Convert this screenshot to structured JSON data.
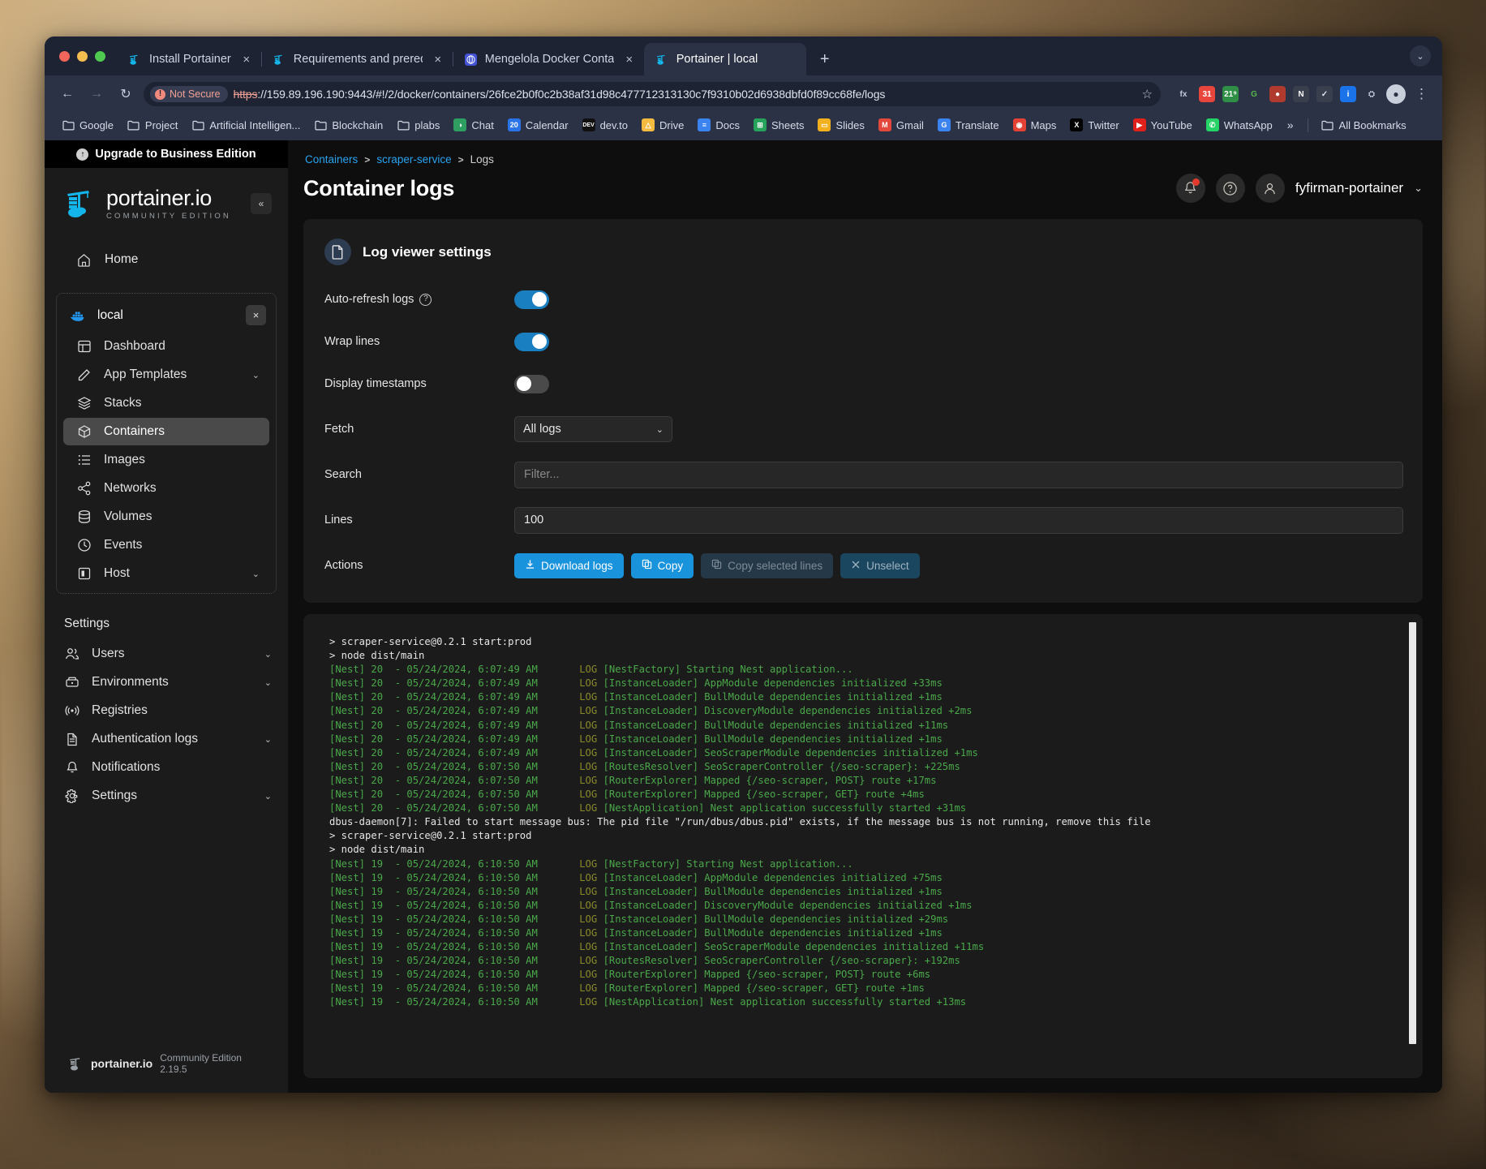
{
  "browser": {
    "tabs": [
      {
        "title": "Install Portainer",
        "favicon": "portainer-icon",
        "active": false
      },
      {
        "title": "Requirements and prerequisit",
        "favicon": "portainer-icon",
        "active": false
      },
      {
        "title": "Mengelola Docker Container c",
        "favicon": "medium-icon",
        "active": false
      },
      {
        "title": "Portainer | local",
        "favicon": "portainer-icon",
        "active": true
      }
    ],
    "new_tab_label": "+",
    "tab_close_label": "×",
    "tablist_chevron": "⌄",
    "nav": {
      "back": "←",
      "forward": "→",
      "reload": "↻"
    },
    "omnibox": {
      "security_label": "Not Secure",
      "security_icon": "not-secure-icon",
      "scheme": "https",
      "url_rest": "://159.89.196.190:9443/#!/2/docker/containers/26fce2b0f0c2b38af31d98c477712313130c7f9310b02d6938dbfd0f89cc68fe/logs",
      "bookmark_star": "☆"
    },
    "extensions": [
      {
        "name": "fx-extension-icon",
        "glyph": "fx",
        "bg": "transparent",
        "fg": "#c3cadb"
      },
      {
        "name": "calendar-31-extension-icon",
        "glyph": "31",
        "bg": "#e8453c",
        "fg": "#ffffff"
      },
      {
        "name": "calendar-219-extension-icon",
        "glyph": "21⁹",
        "bg": "#2f8f46",
        "fg": "#ffffff"
      },
      {
        "name": "grammarly-extension-icon",
        "glyph": "G",
        "bg": "transparent",
        "fg": "#57b64b"
      },
      {
        "name": "ublock-extension-icon",
        "glyph": "●",
        "bg": "#b03a2e",
        "fg": "#ffffff"
      },
      {
        "name": "notion-extension-icon",
        "glyph": "N",
        "bg": "#3a3f4d",
        "fg": "#ffffff"
      },
      {
        "name": "checkbox-extension-icon",
        "glyph": "✓",
        "bg": "#3a3f4d",
        "fg": "#dce3f0"
      },
      {
        "name": "info-extension-icon",
        "glyph": "i",
        "bg": "#1a73e8",
        "fg": "#ffffff"
      },
      {
        "name": "puzzle-extension-icon",
        "glyph": "⛭",
        "bg": "transparent",
        "fg": "#c3cadb"
      }
    ],
    "profile_initial": "●",
    "menu_glyph": "⋮",
    "bookmarks": [
      {
        "label": "Google",
        "icon": "folder-icon"
      },
      {
        "label": "Project",
        "icon": "folder-icon"
      },
      {
        "label": "Artificial Intelligen...",
        "icon": "folder-icon"
      },
      {
        "label": "Blockchain",
        "icon": "folder-icon"
      },
      {
        "label": "plabs",
        "icon": "folder-icon"
      },
      {
        "label": "Chat",
        "icon": "google-chat-icon"
      },
      {
        "label": "Calendar",
        "icon": "google-calendar-icon"
      },
      {
        "label": "dev.to",
        "icon": "devto-icon"
      },
      {
        "label": "Drive",
        "icon": "google-drive-icon"
      },
      {
        "label": "Docs",
        "icon": "google-docs-icon"
      },
      {
        "label": "Sheets",
        "icon": "google-sheets-icon"
      },
      {
        "label": "Slides",
        "icon": "google-slides-icon"
      },
      {
        "label": "Gmail",
        "icon": "gmail-icon"
      },
      {
        "label": "Translate",
        "icon": "google-translate-icon"
      },
      {
        "label": "Maps",
        "icon": "google-maps-icon"
      },
      {
        "label": "Twitter",
        "icon": "twitter-x-icon"
      },
      {
        "label": "YouTube",
        "icon": "youtube-icon"
      },
      {
        "label": "WhatsApp",
        "icon": "whatsapp-icon"
      }
    ],
    "bookmarks_overflow": "»",
    "all_bookmarks_label": "All Bookmarks"
  },
  "sidebar": {
    "upgrade_label": "Upgrade to Business Edition",
    "brand_name": "portainer.io",
    "brand_edition": "COMMUNITY EDITION",
    "collapse_glyph": "«",
    "home_label": "Home",
    "environment": {
      "name": "local",
      "close_glyph": "×",
      "items": [
        {
          "label": "Dashboard",
          "icon": "dashboard-icon",
          "chevron": false,
          "active": false
        },
        {
          "label": "App Templates",
          "icon": "templates-icon",
          "chevron": true,
          "active": false
        },
        {
          "label": "Stacks",
          "icon": "stacks-icon",
          "chevron": false,
          "active": false
        },
        {
          "label": "Containers",
          "icon": "containers-icon",
          "chevron": false,
          "active": true
        },
        {
          "label": "Images",
          "icon": "images-icon",
          "chevron": false,
          "active": false
        },
        {
          "label": "Networks",
          "icon": "networks-icon",
          "chevron": false,
          "active": false
        },
        {
          "label": "Volumes",
          "icon": "volumes-icon",
          "chevron": false,
          "active": false
        },
        {
          "label": "Events",
          "icon": "events-icon",
          "chevron": false,
          "active": false
        },
        {
          "label": "Host",
          "icon": "host-icon",
          "chevron": true,
          "active": false
        }
      ]
    },
    "settings_heading": "Settings",
    "settings_items": [
      {
        "label": "Users",
        "icon": "users-icon",
        "chevron": true
      },
      {
        "label": "Environments",
        "icon": "environments-icon",
        "chevron": true
      },
      {
        "label": "Registries",
        "icon": "registries-icon",
        "chevron": false
      },
      {
        "label": "Authentication logs",
        "icon": "auth-logs-icon",
        "chevron": true
      },
      {
        "label": "Notifications",
        "icon": "bell-icon",
        "chevron": false
      },
      {
        "label": "Settings",
        "icon": "gear-icon",
        "chevron": true
      }
    ],
    "footer_brand": "portainer.io",
    "footer_version": "Community Edition 2.19.5"
  },
  "header": {
    "breadcrumb": [
      {
        "label": "Containers",
        "link": true
      },
      {
        "label": "scraper-service",
        "link": true
      },
      {
        "label": "Logs",
        "link": false
      }
    ],
    "breadcrumb_sep": ">",
    "page_title": "Container logs",
    "notifications_icon": "bell-icon",
    "help_icon": "help-icon",
    "avatar_icon": "user-avatar-icon",
    "username": "fyfirman-portainer",
    "user_chevron": "⌄"
  },
  "log_settings": {
    "card_title": "Log viewer settings",
    "card_icon": "document-icon",
    "auto_refresh": {
      "label": "Auto-refresh logs",
      "help": "?",
      "value": true
    },
    "wrap_lines": {
      "label": "Wrap lines",
      "value": true
    },
    "display_timestamps": {
      "label": "Display timestamps",
      "value": false
    },
    "fetch": {
      "label": "Fetch",
      "value": "All logs",
      "options": [
        "All logs"
      ],
      "chevron": "⌄"
    },
    "search": {
      "label": "Search",
      "placeholder": "Filter...",
      "value": ""
    },
    "lines": {
      "label": "Lines",
      "value": "100"
    },
    "actions": {
      "label": "Actions",
      "buttons": [
        {
          "label": "Download logs",
          "icon": "download-icon",
          "style": "primary"
        },
        {
          "label": "Copy",
          "icon": "copy-icon",
          "style": "primary"
        },
        {
          "label": "Copy selected lines",
          "icon": "copy-icon",
          "style": "disabled"
        },
        {
          "label": "Unselect",
          "icon": "close-icon",
          "style": "disabled-alt"
        }
      ]
    },
    "accent_color": "#1a93dd",
    "toggle_on_color": "#1a7fc1"
  },
  "logs": {
    "lines": [
      {
        "type": "plain",
        "text": "> scraper-service@0.2.1 start:prod"
      },
      {
        "type": "plain",
        "text": "> node dist/main"
      },
      {
        "type": "nest",
        "pid": "[Nest] 20  -",
        "ts": "05/24/2024, 6:07:49 AM",
        "lvl": "LOG",
        "ctx": "[NestFactory]",
        "msg": "Starting Nest application..."
      },
      {
        "type": "nest",
        "pid": "[Nest] 20  -",
        "ts": "05/24/2024, 6:07:49 AM",
        "lvl": "LOG",
        "ctx": "[InstanceLoader]",
        "msg": "AppModule dependencies initialized +33ms"
      },
      {
        "type": "nest",
        "pid": "[Nest] 20  -",
        "ts": "05/24/2024, 6:07:49 AM",
        "lvl": "LOG",
        "ctx": "[InstanceLoader]",
        "msg": "BullModule dependencies initialized +1ms"
      },
      {
        "type": "nest",
        "pid": "[Nest] 20  -",
        "ts": "05/24/2024, 6:07:49 AM",
        "lvl": "LOG",
        "ctx": "[InstanceLoader]",
        "msg": "DiscoveryModule dependencies initialized +2ms"
      },
      {
        "type": "nest",
        "pid": "[Nest] 20  -",
        "ts": "05/24/2024, 6:07:49 AM",
        "lvl": "LOG",
        "ctx": "[InstanceLoader]",
        "msg": "BullModule dependencies initialized +11ms"
      },
      {
        "type": "nest",
        "pid": "[Nest] 20  -",
        "ts": "05/24/2024, 6:07:49 AM",
        "lvl": "LOG",
        "ctx": "[InstanceLoader]",
        "msg": "BullModule dependencies initialized +1ms"
      },
      {
        "type": "nest",
        "pid": "[Nest] 20  -",
        "ts": "05/24/2024, 6:07:49 AM",
        "lvl": "LOG",
        "ctx": "[InstanceLoader]",
        "msg": "SeoScraperModule dependencies initialized +1ms"
      },
      {
        "type": "nest",
        "pid": "[Nest] 20  -",
        "ts": "05/24/2024, 6:07:50 AM",
        "lvl": "LOG",
        "ctx": "[RoutesResolver]",
        "msg": "SeoScraperController {/seo-scraper}: +225ms"
      },
      {
        "type": "nest",
        "pid": "[Nest] 20  -",
        "ts": "05/24/2024, 6:07:50 AM",
        "lvl": "LOG",
        "ctx": "[RouterExplorer]",
        "msg": "Mapped {/seo-scraper, POST} route +17ms"
      },
      {
        "type": "nest",
        "pid": "[Nest] 20  -",
        "ts": "05/24/2024, 6:07:50 AM",
        "lvl": "LOG",
        "ctx": "[RouterExplorer]",
        "msg": "Mapped {/seo-scraper, GET} route +4ms"
      },
      {
        "type": "nest",
        "pid": "[Nest] 20  -",
        "ts": "05/24/2024, 6:07:50 AM",
        "lvl": "LOG",
        "ctx": "[NestApplication]",
        "msg": "Nest application successfully started +31ms"
      },
      {
        "type": "plain",
        "text": "dbus-daemon[7]: Failed to start message bus: The pid file \"/run/dbus/dbus.pid\" exists, if the message bus is not running, remove this file"
      },
      {
        "type": "plain",
        "text": "> scraper-service@0.2.1 start:prod"
      },
      {
        "type": "plain",
        "text": "> node dist/main"
      },
      {
        "type": "nest",
        "pid": "[Nest] 19  -",
        "ts": "05/24/2024, 6:10:50 AM",
        "lvl": "LOG",
        "ctx": "[NestFactory]",
        "msg": "Starting Nest application..."
      },
      {
        "type": "nest",
        "pid": "[Nest] 19  -",
        "ts": "05/24/2024, 6:10:50 AM",
        "lvl": "LOG",
        "ctx": "[InstanceLoader]",
        "msg": "AppModule dependencies initialized +75ms"
      },
      {
        "type": "nest",
        "pid": "[Nest] 19  -",
        "ts": "05/24/2024, 6:10:50 AM",
        "lvl": "LOG",
        "ctx": "[InstanceLoader]",
        "msg": "BullModule dependencies initialized +1ms"
      },
      {
        "type": "nest",
        "pid": "[Nest] 19  -",
        "ts": "05/24/2024, 6:10:50 AM",
        "lvl": "LOG",
        "ctx": "[InstanceLoader]",
        "msg": "DiscoveryModule dependencies initialized +1ms"
      },
      {
        "type": "nest",
        "pid": "[Nest] 19  -",
        "ts": "05/24/2024, 6:10:50 AM",
        "lvl": "LOG",
        "ctx": "[InstanceLoader]",
        "msg": "BullModule dependencies initialized +29ms"
      },
      {
        "type": "nest",
        "pid": "[Nest] 19  -",
        "ts": "05/24/2024, 6:10:50 AM",
        "lvl": "LOG",
        "ctx": "[InstanceLoader]",
        "msg": "BullModule dependencies initialized +1ms"
      },
      {
        "type": "nest",
        "pid": "[Nest] 19  -",
        "ts": "05/24/2024, 6:10:50 AM",
        "lvl": "LOG",
        "ctx": "[InstanceLoader]",
        "msg": "SeoScraperModule dependencies initialized +11ms"
      },
      {
        "type": "nest",
        "pid": "[Nest] 19  -",
        "ts": "05/24/2024, 6:10:50 AM",
        "lvl": "LOG",
        "ctx": "[RoutesResolver]",
        "msg": "SeoScraperController {/seo-scraper}: +192ms"
      },
      {
        "type": "nest",
        "pid": "[Nest] 19  -",
        "ts": "05/24/2024, 6:10:50 AM",
        "lvl": "LOG",
        "ctx": "[RouterExplorer]",
        "msg": "Mapped {/seo-scraper, POST} route +6ms"
      },
      {
        "type": "nest",
        "pid": "[Nest] 19  -",
        "ts": "05/24/2024, 6:10:50 AM",
        "lvl": "LOG",
        "ctx": "[RouterExplorer]",
        "msg": "Mapped {/seo-scraper, GET} route +1ms"
      },
      {
        "type": "nest",
        "pid": "[Nest] 19  -",
        "ts": "05/24/2024, 6:10:50 AM",
        "lvl": "LOG",
        "ctx": "[NestApplication]",
        "msg": "Nest application successfully started +13ms"
      }
    ]
  }
}
